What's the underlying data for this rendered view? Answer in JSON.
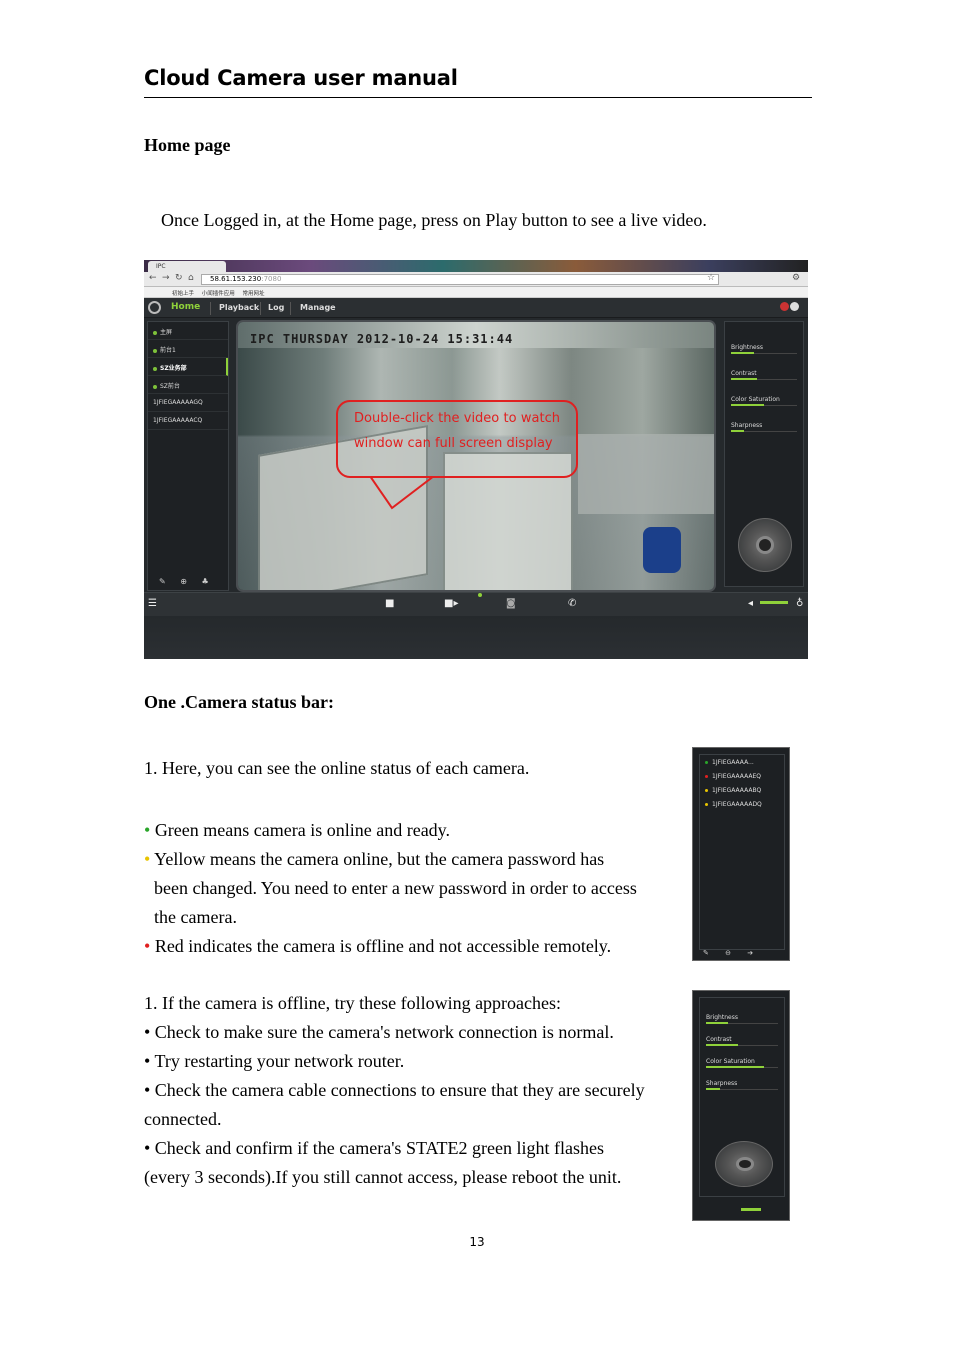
{
  "header": {
    "title": "Cloud Camera user manual"
  },
  "section1": {
    "heading": "Home page",
    "intro": "Once Logged in, at the Home page, press on Play button to see a live video."
  },
  "screenshot": {
    "tab_label": "IPC",
    "url_host": "58.61.153.230",
    "url_port": ":7080",
    "bookmarks": "初始上手   小闻插件应用   常用网址",
    "nav": {
      "home": "Home",
      "playback": "Playback",
      "log": "Log",
      "manage": "Manage"
    },
    "cameras": [
      {
        "label": "主屏",
        "status": "online"
      },
      {
        "label": "前台1",
        "status": "online"
      },
      {
        "label": "SZ业务部",
        "status": "online",
        "selected": true
      },
      {
        "label": "SZ前台",
        "status": "online"
      },
      {
        "label": "1JFIEGAAAAAGQ",
        "status": "none"
      },
      {
        "label": "1JFIEGAAAAACQ",
        "status": "none"
      }
    ],
    "osd": "IPC THURSDAY 2012-10-24 15:31:44",
    "callout": "Double-click the video to watch window can full screen display",
    "sliders": [
      {
        "label": "Brightness",
        "level": 0.35
      },
      {
        "label": "Contrast",
        "level": 0.4
      },
      {
        "label": "Color Saturation",
        "level": 0.5
      },
      {
        "label": "Sharpness",
        "level": 0.2
      }
    ]
  },
  "section2": {
    "heading": "One .Camera status bar:",
    "item1": "1.   Here, you can see the online status of each camera.",
    "bullets": [
      {
        "color": "#2aa52a",
        "lines": [
          "Green means camera is online and ready."
        ]
      },
      {
        "color": "#e8c400",
        "lines": [
          "Yellow means the camera online, but the camera password has",
          "been changed. You need to enter a new password in order to access",
          "the camera."
        ]
      },
      {
        "color": "#e02020",
        "lines": [
          "Red indicates the camera is offline and not accessible remotely."
        ]
      }
    ],
    "item2": "1.   If the camera is offline, try these following approaches:",
    "tips": [
      "• Check to make sure the camera's network connection is normal.",
      "• Try restarting your network router.",
      "• Check the camera cable connections to ensure that they are securely",
      "connected.",
      "• Check and confirm if the camera's STATE2 green light flashes",
      "(every 3 seconds).If you still cannot access, please reboot the unit."
    ]
  },
  "inset1": {
    "cameras": [
      {
        "label": "1JFIEGAAAA...",
        "color": "#2aa52a"
      },
      {
        "label": "1JFIEGAAAAAEQ",
        "color": "#e02020"
      },
      {
        "label": "1JFIEGAAAAABQ",
        "color": "#e8c400"
      },
      {
        "label": "1JFIEGAAAAADQ",
        "color": "#e8c400"
      }
    ]
  },
  "inset2": {
    "sliders": [
      "Brightness",
      "Contrast",
      "Color Saturation",
      "Sharpness"
    ]
  },
  "page_number": "13"
}
